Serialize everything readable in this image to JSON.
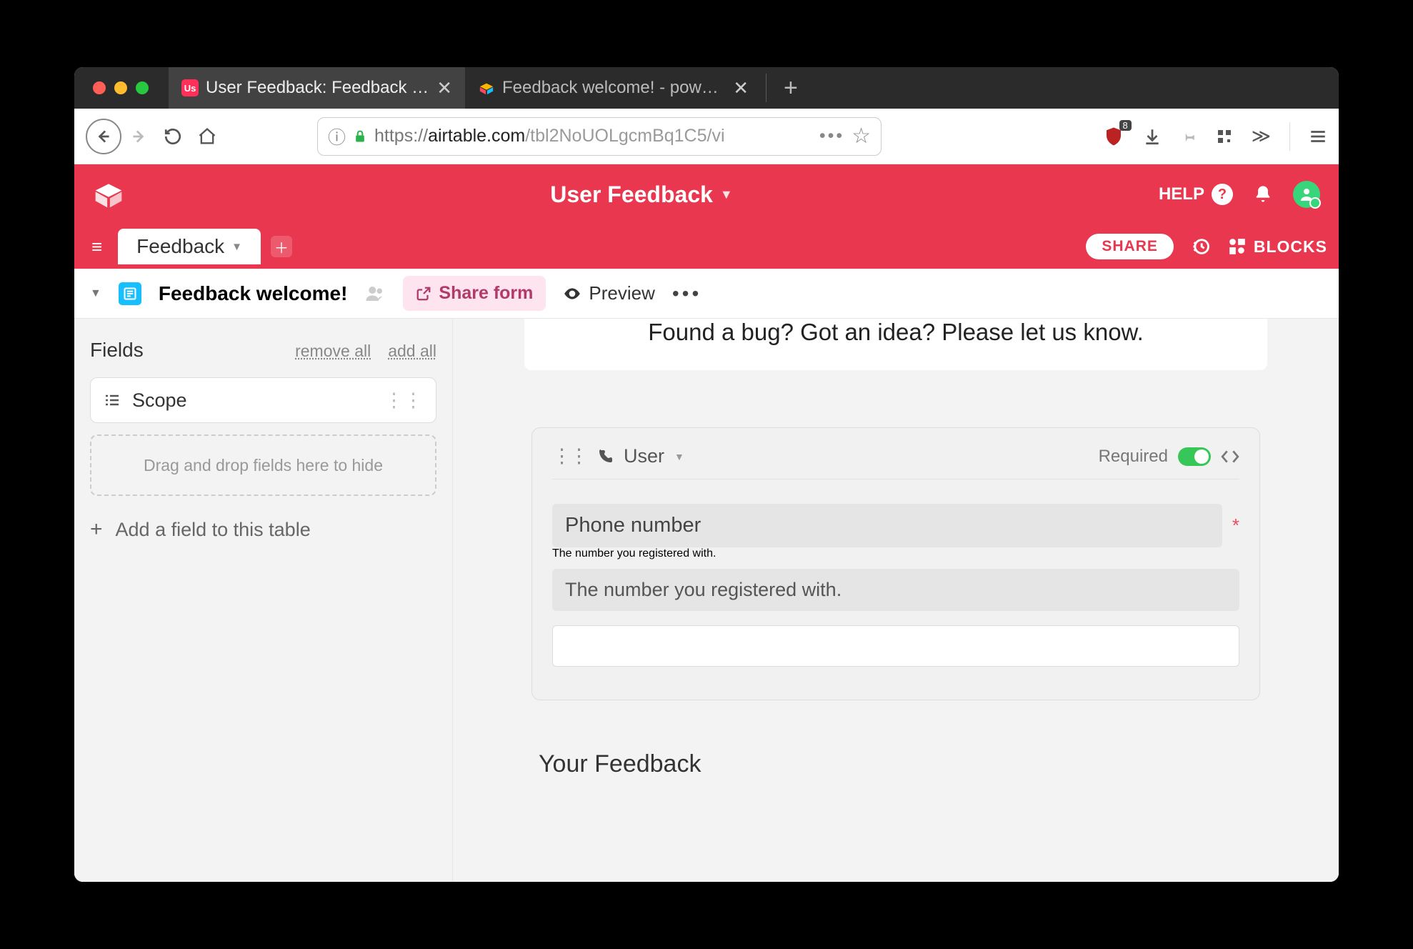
{
  "browser": {
    "tabs": [
      {
        "title": "User Feedback: Feedback - Airt",
        "favicon": "Us"
      },
      {
        "title": "Feedback welcome! - powered"
      }
    ],
    "url_prefix": "https://",
    "url_host": "airtable.com",
    "url_path": "/tbl2NoUOLgcmBq1C5/vi",
    "ublock_badge": "8"
  },
  "airtable": {
    "base_name": "User Feedback",
    "help_label": "HELP",
    "table_tab": "Feedback",
    "share_label": "SHARE",
    "blocks_label": "BLOCKS"
  },
  "viewbar": {
    "view_name": "Feedback welcome!",
    "share_form": "Share form",
    "preview": "Preview"
  },
  "sidebar": {
    "fields_title": "Fields",
    "remove_all": "remove all",
    "add_all": "add all",
    "available_field": "Scope",
    "dropzone_text": "Drag and drop fields here to hide",
    "add_field": "Add a field to this table"
  },
  "form": {
    "subtitle_partial": "Found a bug? Got an idea? Please let us know.",
    "field_name": "User",
    "required_label": "Required",
    "field_label": "Phone number",
    "field_help": "The number you registered with.",
    "next_section": "Your Feedback"
  }
}
